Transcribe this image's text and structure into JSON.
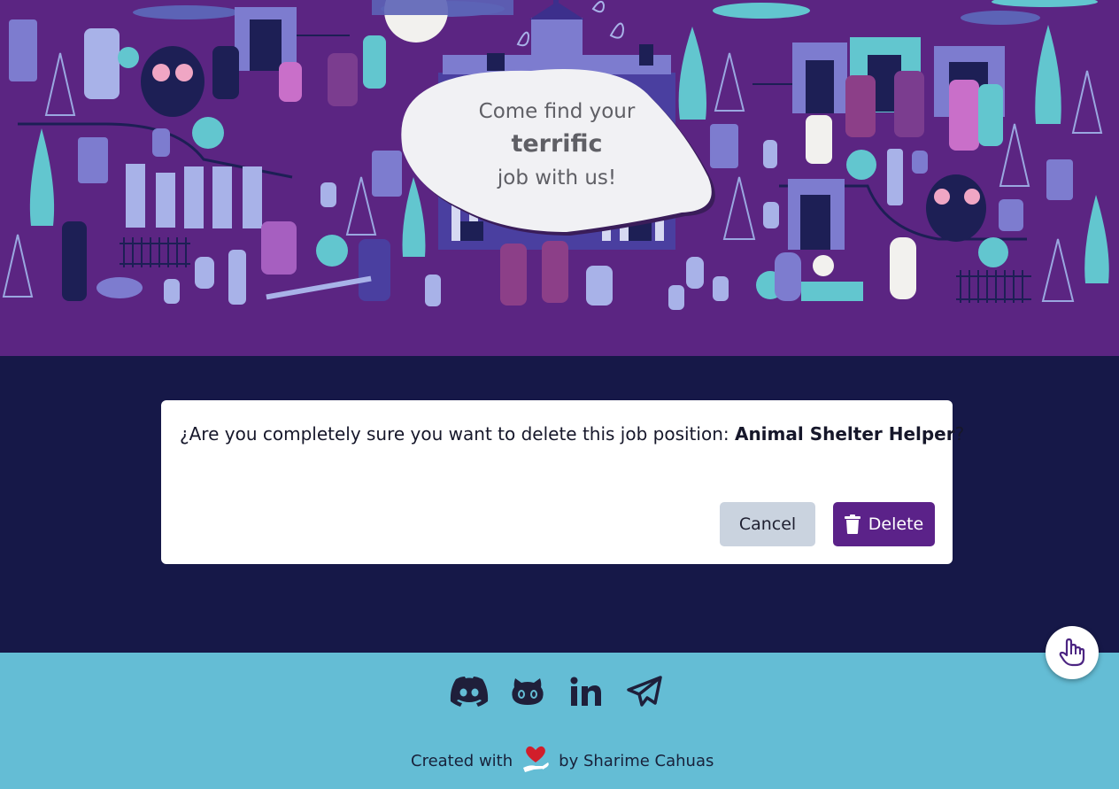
{
  "hero": {
    "bubble": {
      "line1": "Come find your",
      "line2": "terrific",
      "line3": "job with us!"
    },
    "colors": {
      "background": "#5b2582",
      "accent": "#5ec6cf",
      "tree": "#62c6cf"
    }
  },
  "dialog": {
    "message_prefix": "¿Are you completely sure you want to delete this job position: ",
    "job_title": "Animal Shelter Helper",
    "message_suffix": "?",
    "cancel_label": "Cancel",
    "delete_label": "Delete",
    "delete_icon": "trash-icon"
  },
  "footer": {
    "socials": [
      {
        "name": "Discord",
        "icon": "discord-icon"
      },
      {
        "name": "GitHub",
        "icon": "github-icon"
      },
      {
        "name": "LinkedIn",
        "icon": "linkedin-icon"
      },
      {
        "name": "Telegram",
        "icon": "paper-plane-icon"
      }
    ],
    "credit_prefix": "Created with",
    "credit_suffix": "by Sharime Cahuas",
    "credit_icon": "heart-hand-icon"
  },
  "floating_button": {
    "icon": "pointer-hand-icon"
  },
  "colors": {
    "main_background": "#161848",
    "footer_background": "#64bdd5",
    "delete_button": "#5b2289",
    "cancel_button": "#cad3df"
  }
}
